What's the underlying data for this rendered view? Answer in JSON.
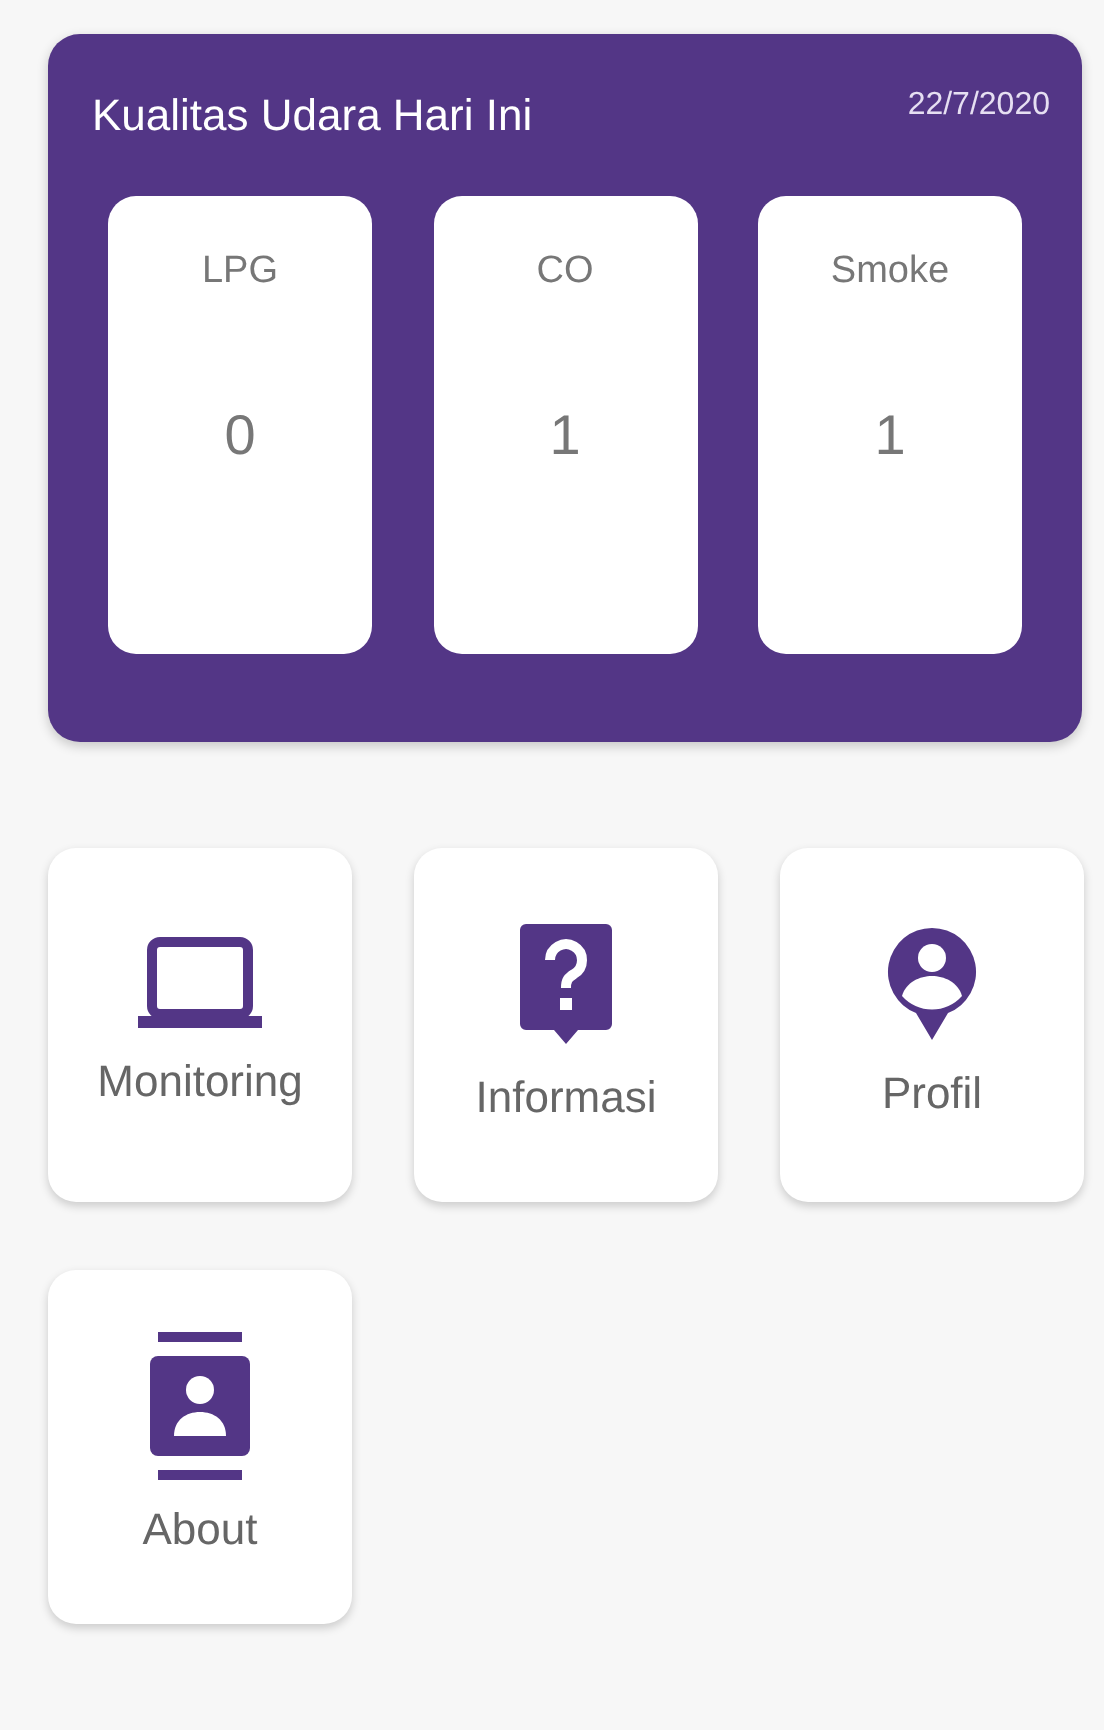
{
  "air_quality": {
    "title": "Kualitas Udara Hari Ini",
    "date": "22/7/2020",
    "sensors": [
      {
        "label": "LPG",
        "value": "0"
      },
      {
        "label": "CO",
        "value": "1"
      },
      {
        "label": "Smoke",
        "value": "1"
      }
    ]
  },
  "menu": [
    {
      "label": "Monitoring"
    },
    {
      "label": "Informasi"
    },
    {
      "label": "Profil"
    },
    {
      "label": "About"
    }
  ]
}
